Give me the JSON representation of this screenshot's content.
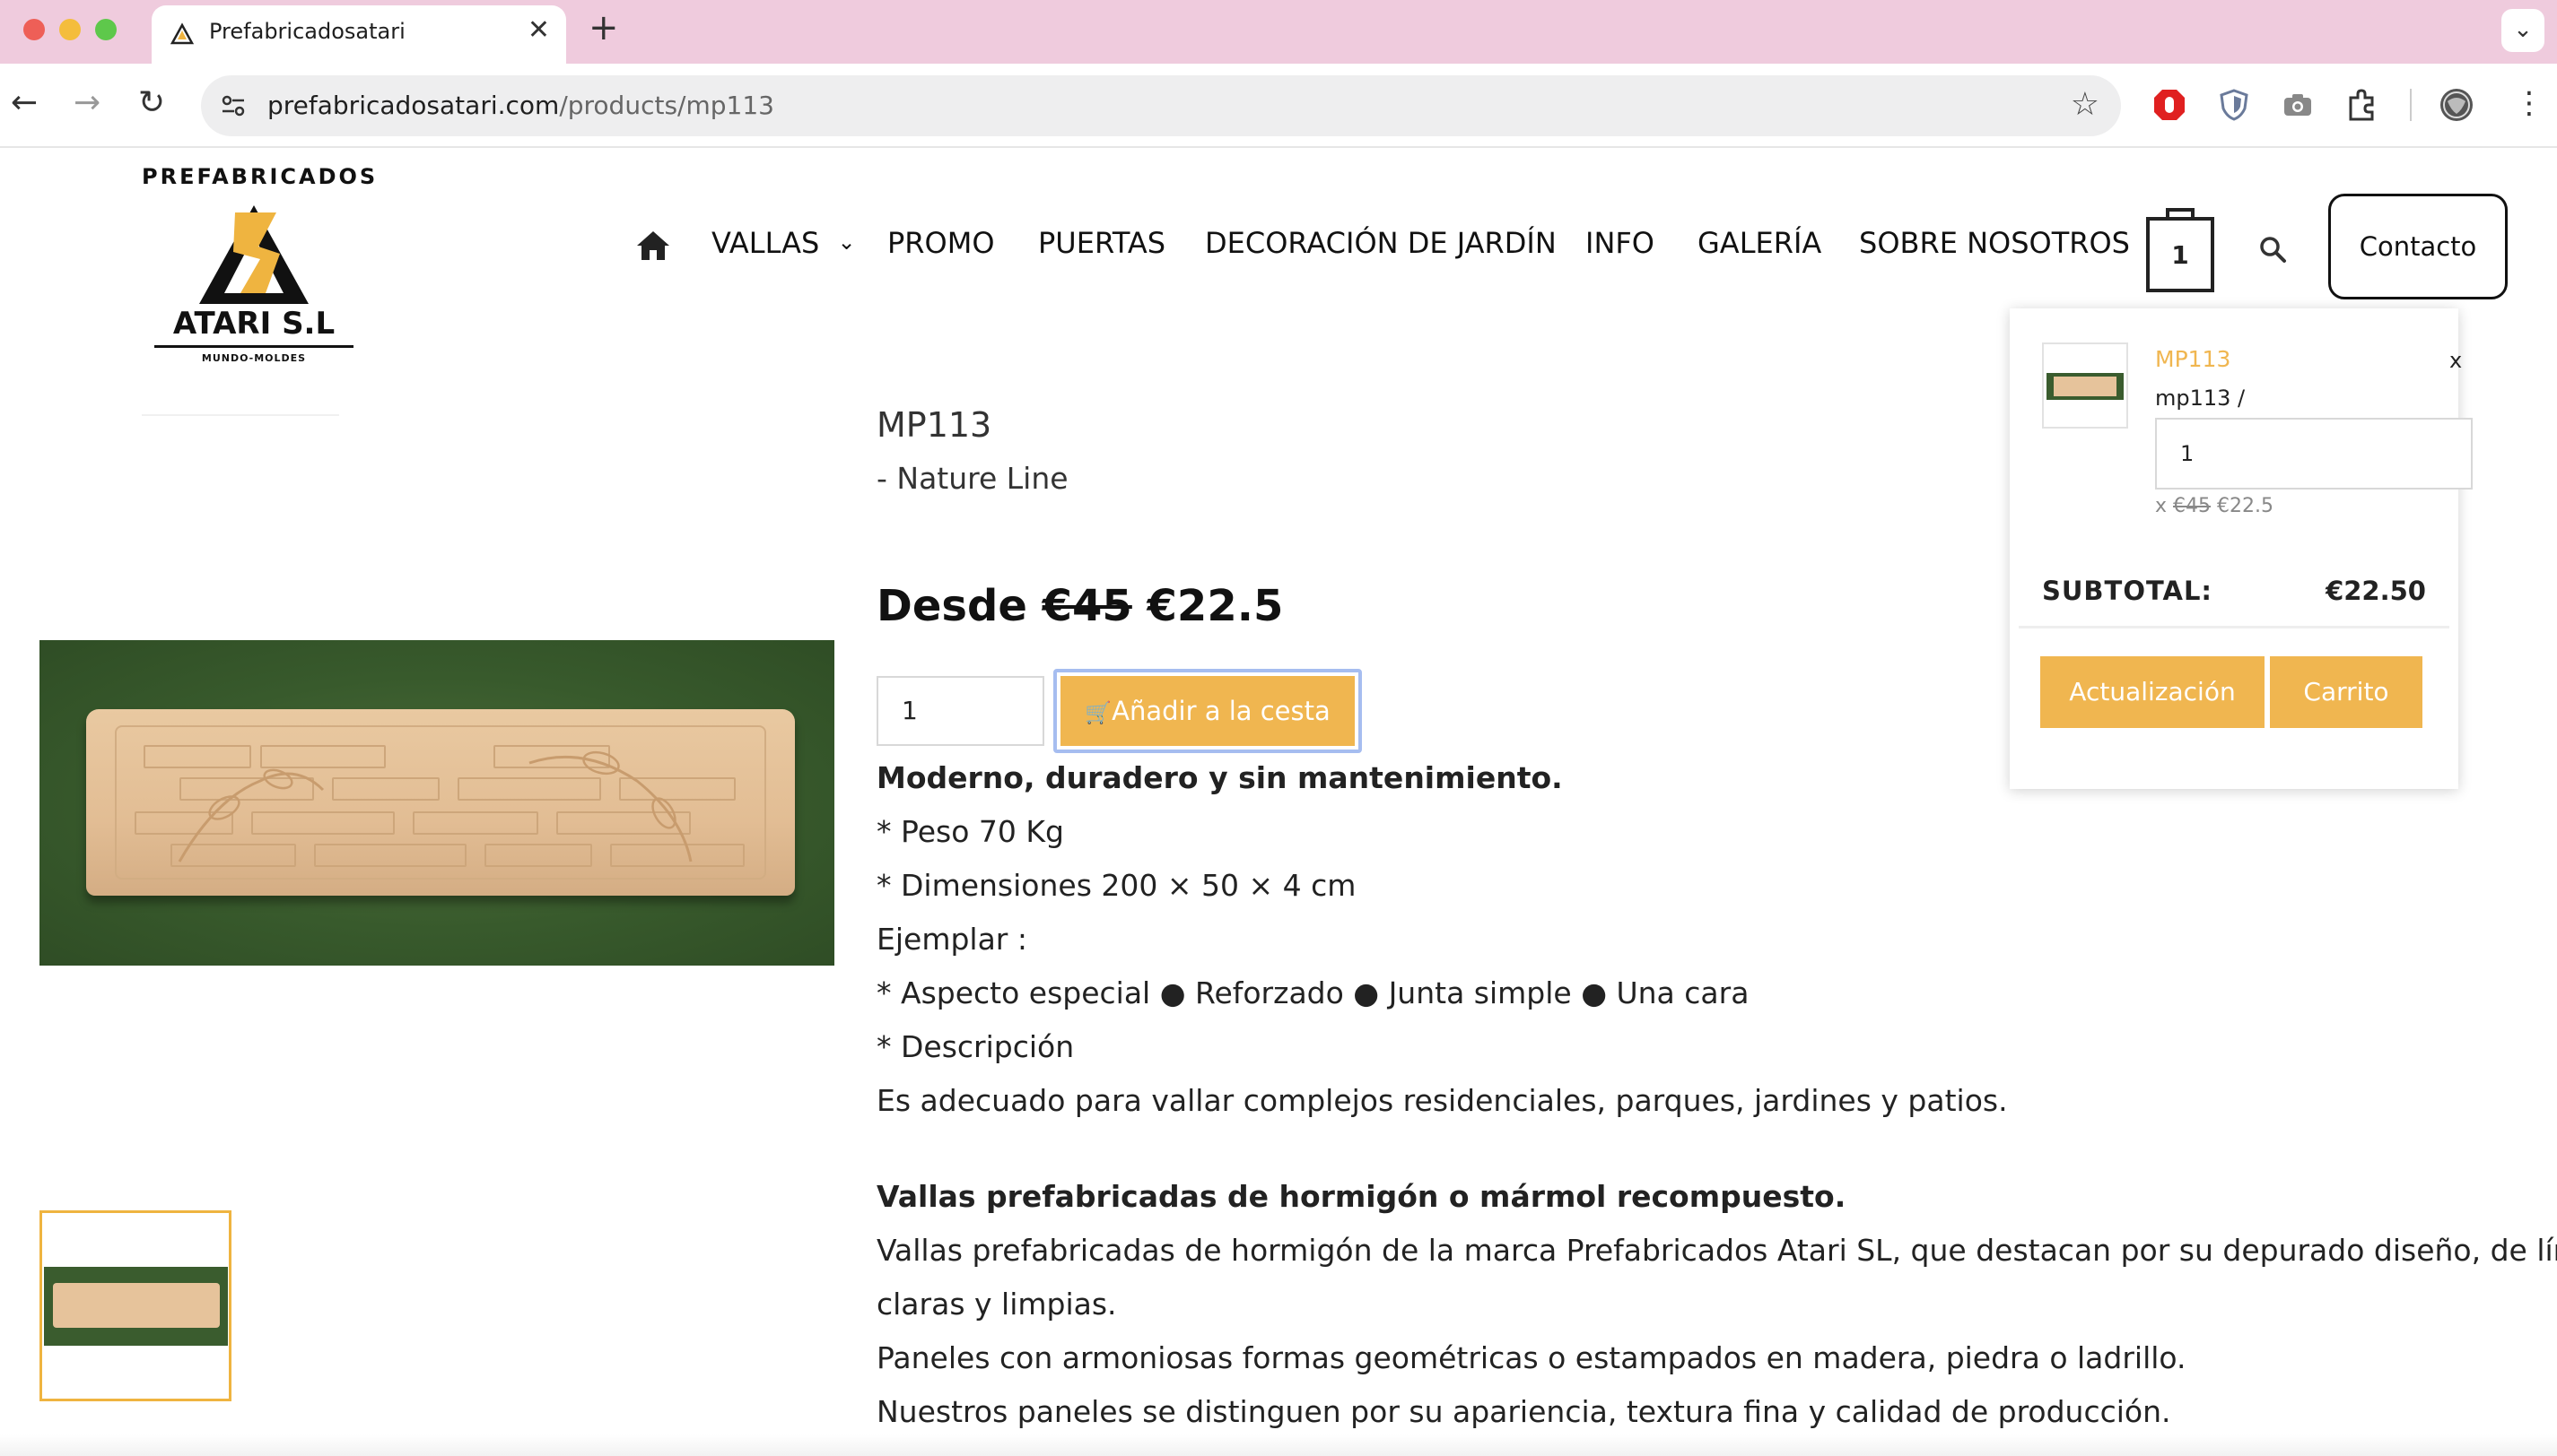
{
  "browser": {
    "tab_title": "Prefabricadosatari",
    "url_host": "prefabricadosatari.com",
    "url_path": "/products/mp113",
    "new_tab_glyph": "+",
    "close_glyph": "✕",
    "tab_menu_glyph": "⌄",
    "back_glyph": "←",
    "forward_glyph": "→",
    "reload_glyph": "↻",
    "star_glyph": "☆",
    "menu_glyph": "⋮"
  },
  "logo": {
    "top_text": "PREFABRICADOS",
    "name": "ATARI S.L",
    "tagline": "MUNDO-MOLDES",
    "colors": {
      "gold": "#efb440",
      "dark": "#111111"
    }
  },
  "nav": {
    "items": [
      {
        "label": "VALLAS",
        "has_dropdown": true
      },
      {
        "label": "PROMO"
      },
      {
        "label": "PUERTAS"
      },
      {
        "label": "DECORACIÓN DE JARDÍN"
      },
      {
        "label": "INFO"
      },
      {
        "label": "GALERÍA"
      },
      {
        "label": "SOBRE NOSOTROS"
      }
    ],
    "dropdown_glyph": "⌄",
    "cart_count": "1",
    "contact_label": "Contacto"
  },
  "product": {
    "title": "MP113",
    "subtitle": "- Nature Line",
    "price_prefix": "Desde",
    "price_old": "€45",
    "price_new": "€22.5",
    "quantity": "1",
    "add_to_cart_label": "Añadir a la cesta",
    "cart_glyph": "🛒",
    "description": [
      {
        "text": "Moderno, duradero y sin mantenimiento.",
        "bold": true
      },
      {
        "text": "* Peso 70 Kg"
      },
      {
        "text": "* Dimensiones 200 × 50 × 4 cm"
      },
      {
        "text": "Ejemplar :"
      },
      {
        "text": "* Aspecto especial ● Reforzado ● Junta simple ● Una cara"
      },
      {
        "text": "* Descripción"
      },
      {
        "text": "Es adecuado para vallar complejos residenciales, parques, jardines y patios."
      },
      {
        "text": "Vallas prefabricadas de hormigón o mármol recompuesto.",
        "bold": true
      },
      {
        "text": "Vallas prefabricadas de hormigón de la marca Prefabricados Atari SL, que destacan por su depurado diseño, de líneas"
      },
      {
        "text": "claras y limpias."
      },
      {
        "text": "Paneles con armoniosas formas geométricas o estampados en madera, piedra o ladrillo."
      },
      {
        "text": "Nuestros paneles se distinguen por su apariencia, textura fina y calidad de producción."
      }
    ]
  },
  "minicart": {
    "item_name": "MP113",
    "item_variant": "mp113 /",
    "item_qty": "1",
    "price_prefix": "x",
    "item_price_old": "€45",
    "item_price_new": "€22.5",
    "remove_label": "x",
    "subtotal_label": "SUBTOTAL:",
    "subtotal_value": "€22.50",
    "update_label": "Actualización",
    "cart_label": "Carrito"
  },
  "colors": {
    "accent": "#f0b650",
    "tabbar": "#efcbdd",
    "focus_ring": "#a6bdf0"
  }
}
